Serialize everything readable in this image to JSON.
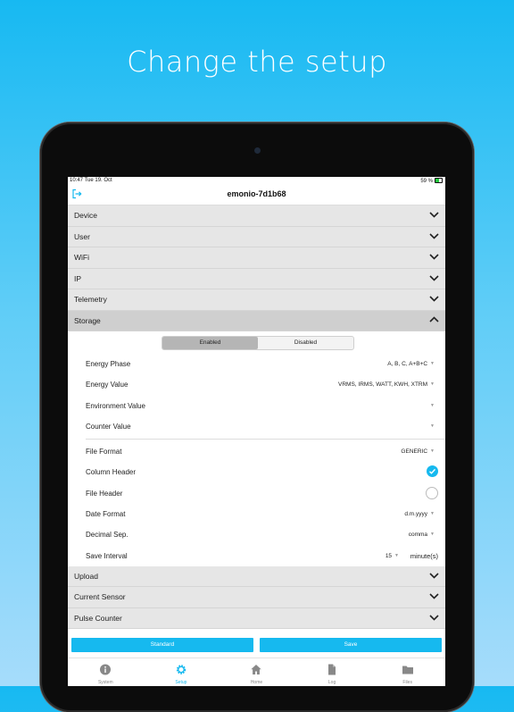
{
  "headline": "Change the setup",
  "status_bar": {
    "time": "10:47",
    "date": "Tue 19. Oct",
    "battery": "59 %"
  },
  "nav": {
    "title": "emonio-7d1b68"
  },
  "sections_top": [
    {
      "label": "Device"
    },
    {
      "label": "User"
    },
    {
      "label": "WiFi"
    },
    {
      "label": "IP"
    },
    {
      "label": "Telemetry"
    }
  ],
  "storage": {
    "label": "Storage",
    "segment": {
      "enabled": "Enabled",
      "disabled": "Disabled",
      "selected": "Enabled"
    },
    "rows": {
      "energy_phase": {
        "label": "Energy Phase",
        "value": "A, B, C, A+B+C"
      },
      "energy_value": {
        "label": "Energy Value",
        "value": "VRMS, IRMS, WATT, KWH, XTRM"
      },
      "environment_value": {
        "label": "Environment Value",
        "value": ""
      },
      "counter_value": {
        "label": "Counter Value",
        "value": ""
      },
      "file_format": {
        "label": "File Format",
        "value": "GENERIC"
      },
      "column_header": {
        "label": "Column Header",
        "checked": true
      },
      "file_header": {
        "label": "File Header",
        "checked": false
      },
      "date_format": {
        "label": "Date Format",
        "value": "d.m.yyyy"
      },
      "decimal_sep": {
        "label": "Decimal Sep.",
        "value": "comma"
      },
      "save_interval": {
        "label": "Save Interval",
        "value": "15",
        "unit": "minute(s)"
      }
    }
  },
  "sections_bottom": [
    {
      "label": "Upload"
    },
    {
      "label": "Current Sensor"
    },
    {
      "label": "Pulse Counter"
    }
  ],
  "buttons": {
    "standard": "Standard",
    "save": "Save"
  },
  "tabs": [
    {
      "label": "System",
      "icon": "info-icon"
    },
    {
      "label": "Setup",
      "icon": "gear-icon",
      "active": true
    },
    {
      "label": "Home",
      "icon": "home-icon"
    },
    {
      "label": "Log",
      "icon": "document-icon"
    },
    {
      "label": "Files",
      "icon": "folder-icon"
    }
  ],
  "colors": {
    "accent": "#16b9ef",
    "background_top": "#17b9f2",
    "section_bg": "#e6e6e6"
  }
}
